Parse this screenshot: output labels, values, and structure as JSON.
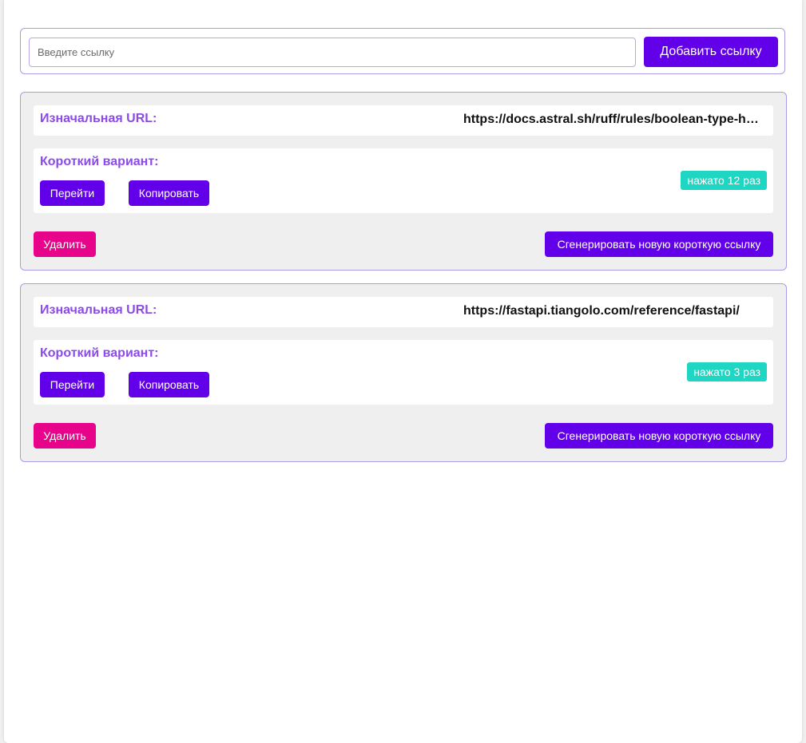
{
  "add_form": {
    "input_placeholder": "Введите ссылку",
    "input_value": "",
    "add_button_label": "Добавить ссылку"
  },
  "links": [
    {
      "original_label": "Изначальная URL:",
      "original_url": "https://docs.astral.sh/ruff/rules/boolean-type-hint-positional-argument/",
      "short_label": "Короткий вариант:",
      "go_label": "Перейти",
      "copy_label": "Копировать",
      "clicks_text": "нажато 12 раз",
      "clicks": 12,
      "delete_label": "Удалить",
      "regenerate_label": "Сгенерировать новую короткую ссылку"
    },
    {
      "original_label": "Изначальная URL:",
      "original_url": "https://fastapi.tiangolo.com/reference/fastapi/",
      "short_label": "Короткий вариант:",
      "go_label": "Перейти",
      "copy_label": "Копировать",
      "clicks_text": "нажато 3 раз",
      "clicks": 3,
      "delete_label": "Удалить",
      "regenerate_label": "Сгенерировать новую короткую ссылку"
    }
  ],
  "colors": {
    "primary": "#6200ea",
    "accent_label": "#8a4be8",
    "danger": "#e8048a",
    "badge": "#1ed6c1",
    "card_bg": "#efefef",
    "border": "#a99ce6"
  }
}
